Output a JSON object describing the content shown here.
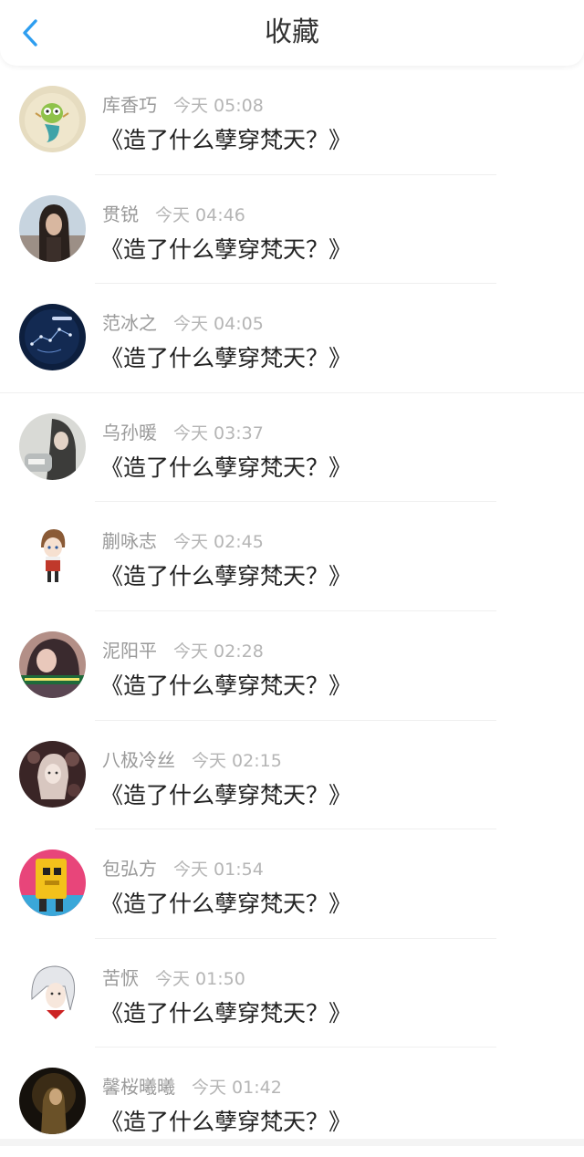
{
  "header": {
    "title": "收藏",
    "back_icon": "chevron-left-icon",
    "accent_color": "#2e9ef0"
  },
  "items": [
    {
      "name": "库香巧",
      "time": "今天 05:08",
      "title": "《造了什么孽穿梵天？》",
      "avatar": "avatar-cartoon-mermaid"
    },
    {
      "name": "贯锐",
      "time": "今天 04:46",
      "title": "《造了什么孽穿梵天？》",
      "avatar": "avatar-woman-photo"
    },
    {
      "name": "范冰之",
      "time": "今天 04:05",
      "title": "《造了什么孽穿梵天？》",
      "avatar": "avatar-constellation"
    },
    {
      "name": "乌孙暖",
      "time": "今天 03:37",
      "title": "《造了什么孽穿梵天？》",
      "avatar": "avatar-girl-photo"
    },
    {
      "name": "蒯咏志",
      "time": "今天 02:45",
      "title": "《造了什么孽穿梵天？》",
      "avatar": "avatar-chibi-boy"
    },
    {
      "name": "泥阳平",
      "time": "今天 02:28",
      "title": "《造了什么孽穿梵天？》",
      "avatar": "avatar-girl-banner"
    },
    {
      "name": "八极冷丝",
      "time": "今天 02:15",
      "title": "《造了什么孽穿梵天？》",
      "avatar": "avatar-anime-sepia"
    },
    {
      "name": "包弘方",
      "time": "今天 01:54",
      "title": "《造了什么孽穿梵天？》",
      "avatar": "avatar-yellow-cartoon"
    },
    {
      "name": "苦恹",
      "time": "今天 01:50",
      "title": "《造了什么孽穿梵天？》",
      "avatar": "avatar-anime-silver-hair"
    },
    {
      "name": "馨桜曦曦",
      "time": "今天 01:42",
      "title": "《造了什么孽穿梵天？》",
      "avatar": "avatar-dark-photo"
    }
  ]
}
